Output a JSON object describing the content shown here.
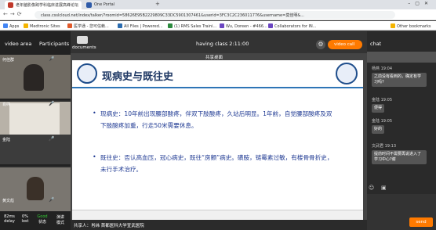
{
  "browser": {
    "tab1": "老年脑影像跨学科临床进展高峰论坛",
    "tab2": "One Portal",
    "url": "class.csslcloud.net/index/talker/?roomid=58626E95B2229809C33DC5901307461&userid=3FC3C2C236011776&username=莫佳明&...",
    "bookmarks": [
      "Apps",
      "Medtronic Sites",
      "医学通 - 您可信赖...",
      "All Files | Powered...",
      "(1) RMS Sales Traini...",
      "Wu, Doreen - #466...",
      "Collaborators for IN...",
      "Other bookmarks"
    ]
  },
  "left": {
    "tabs": {
      "video": "video area",
      "participants": "Participants"
    },
    "videos": [
      {
        "name": "何佳群"
      },
      {
        "name": "肖纬"
      },
      {
        "name": "金陆"
      },
      {
        "name": "黄文彪"
      }
    ],
    "stats": [
      {
        "value": "82ms",
        "label": "delay"
      },
      {
        "value": "0%",
        "label": "lost"
      },
      {
        "value": "Good",
        "label": "状态"
      },
      {
        "value": "演讲",
        "label": "模式"
      }
    ]
  },
  "center": {
    "documents": "documents",
    "timer": "having class 2:11:00",
    "video_call": "video call",
    "share_label": "共享桌面",
    "slide": {
      "title": "现病史与既往史",
      "p1": "现病史：10年前出现腰部酸疼，伴双下肢酸疼，久站后明显。1年前，自觉腰部酸疼及双下肢酸疼加重，行走50米需要休息。",
      "p2": "既往史：否认高血压，冠心病史，既往“房颤”病史。磺胺，链霉素过敏，有楼骨骨折史，未行手术治疗。"
    },
    "share_info": "共享人：肖纬 首都医科大学宣武医院"
  },
  "chat": {
    "title": "chat",
    "messages": [
      {
        "time": "杨燕 19:04",
        "text": "之前没有看到的，确定有学习吗?"
      },
      {
        "time": "金陆 19:05",
        "text": "便得"
      },
      {
        "time": "金陆 19:05",
        "text": "好的"
      },
      {
        "time": "文武君 19:13",
        "text": "提前时间不需要再说进入了学习中心?谢"
      }
    ],
    "send": "send"
  },
  "colors": {
    "accent": "#ff7a00",
    "slide_blue": "#1f3a93"
  }
}
